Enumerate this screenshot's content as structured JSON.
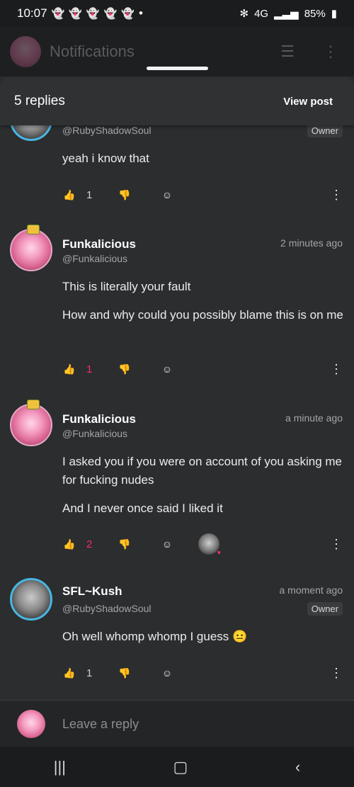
{
  "status": {
    "time": "10:07",
    "ghosts": [
      "👻",
      "👻",
      "👻",
      "👻",
      "👻"
    ],
    "dot": "•",
    "bluetooth": "✻",
    "signal": "4G",
    "battery": "85%"
  },
  "bg_header": {
    "title": "Notifications"
  },
  "sheet": {
    "reply_count": "5 replies",
    "view_post": "View post"
  },
  "comments": [
    {
      "handle": "@RubyShadowSoul",
      "badge": "Owner",
      "lines": [
        "yeah i know that"
      ],
      "likes": "1",
      "liked": false
    },
    {
      "name": "Funkalicious",
      "handle": "@Funkalicious",
      "time": "2 minutes ago",
      "lines": [
        "This is literally your fault",
        "How and why could you possibly blame this is on me"
      ],
      "likes": "1",
      "liked": true
    },
    {
      "name": "Funkalicious",
      "handle": "@Funkalicious",
      "time": "a minute ago",
      "lines": [
        "I asked you if you were on account of you asking me for fucking nudes",
        "And I never once said I liked it"
      ],
      "likes": "2",
      "liked": true
    },
    {
      "name": "SFL~Kush",
      "handle": "@RubyShadowSoul",
      "time": "a moment ago",
      "badge": "Owner",
      "lines": [
        "Oh well whomp whomp I guess 😐"
      ],
      "likes": "1",
      "liked": false
    }
  ],
  "reply": {
    "placeholder": "Leave a reply"
  },
  "icons": {
    "like": "thumbs-up-icon",
    "dislike": "thumbs-down-icon",
    "react": "add-reaction-icon",
    "more": "more-vertical-icon"
  },
  "colors": {
    "accent_like": "#ff2d6a",
    "owner_badge_bg": "#3a3c3f"
  }
}
